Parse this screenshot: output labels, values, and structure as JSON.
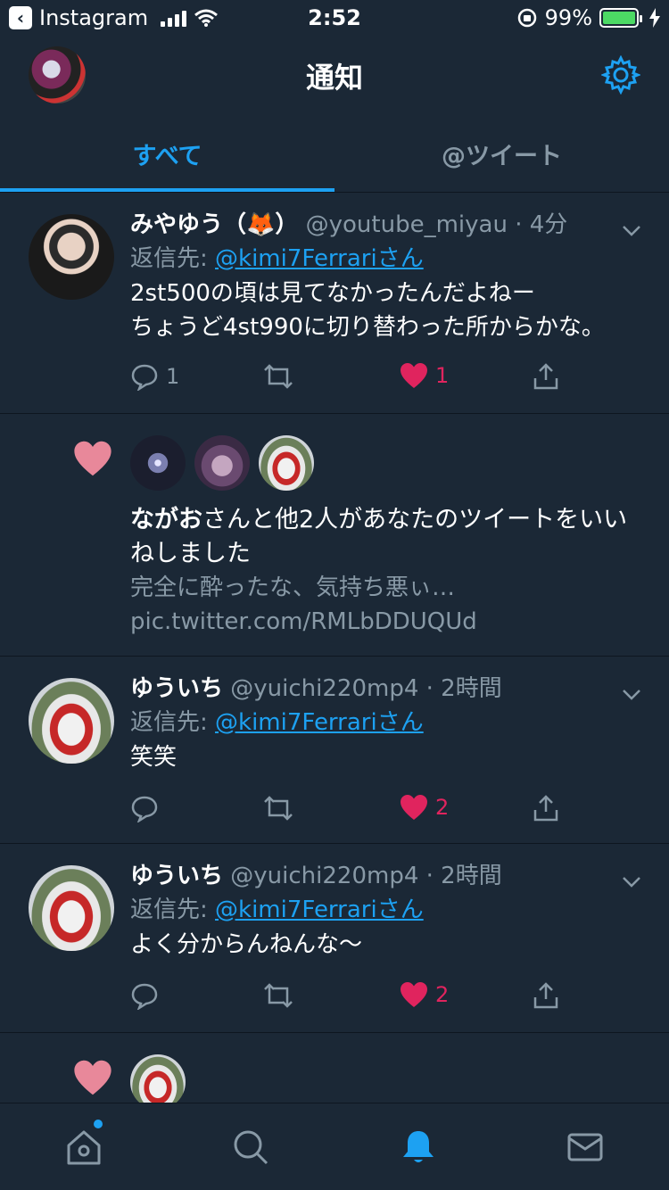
{
  "status_bar": {
    "back_app": "Instagram",
    "time": "2:52",
    "battery": "99%"
  },
  "header": {
    "title": "通知"
  },
  "tabs": [
    {
      "label": "すべて",
      "active": true
    },
    {
      "label": "@ツイート",
      "active": false
    }
  ],
  "feed": {
    "tweet1": {
      "name": "みやゆう（🦊）",
      "handle": "@youtube_miyau",
      "time": "· 4分",
      "reply_prefix": "返信先: ",
      "reply_to": "@kimi7Ferrariさん",
      "text_line1": "2st500の頃は見てなかったんだよねー",
      "text_line2": "ちょうど4st990に切り替わった所からかな。",
      "reply_count": "1",
      "like_count": "1"
    },
    "like1": {
      "actor": "ながお",
      "action": "さんと他2人があなたのツイートをいい",
      "action2": "ねしました",
      "snippet1": "完全に酔ったな、気持ち悪ぃ…",
      "snippet2": "pic.twitter.com/RMLbDDUQUd"
    },
    "tweet2": {
      "name": "ゆういち",
      "handle": "@yuichi220mp4",
      "time": "· 2時間",
      "reply_prefix": "返信先: ",
      "reply_to": "@kimi7Ferrariさん",
      "text_line1": "笑笑",
      "like_count": "2"
    },
    "tweet3": {
      "name": "ゆういち",
      "handle": "@yuichi220mp4",
      "time": "· 2時間",
      "reply_prefix": "返信先: ",
      "reply_to": "@kimi7Ferrariさん",
      "text_line1": "よく分からんねんな〜",
      "like_count": "2"
    }
  },
  "colors": {
    "background": "#1b2836",
    "accent": "#1da1f2",
    "like": "#e0245e",
    "muted": "#8899a6"
  }
}
